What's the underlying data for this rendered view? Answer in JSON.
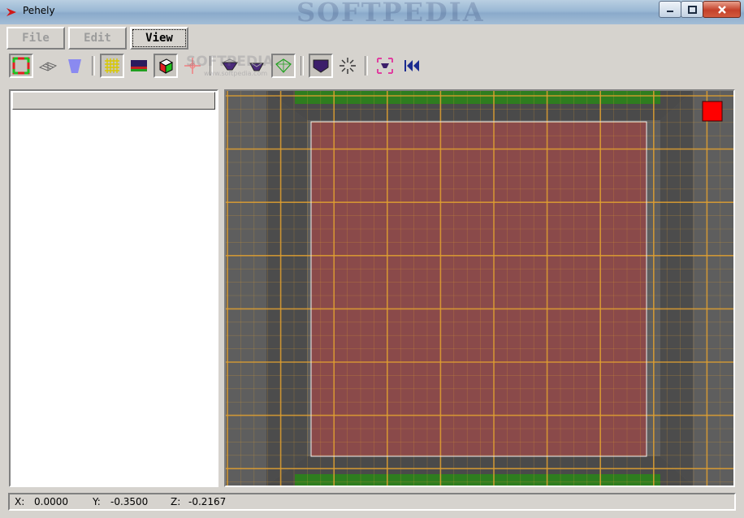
{
  "window": {
    "title": "Pehely",
    "watermark": "SOFTPEDIA"
  },
  "menu": {
    "tabs": [
      {
        "label": "File"
      },
      {
        "label": "Edit"
      },
      {
        "label": "View"
      }
    ]
  },
  "toolbar": {
    "watermark": "SOFTPEDIA",
    "watermark_url": "www.softpedia.com"
  },
  "status": {
    "x_label": "X:",
    "x_value": "0.0000",
    "y_label": "Y:",
    "y_value": "-0.3500",
    "z_label": "Z:",
    "z_value": "-0.2167"
  },
  "colors": {
    "viewport_bg": "#5e5e5e",
    "grid_line": "#e0a030",
    "board_fill": "#8a4a4a",
    "green_strip": "#2e7d1f",
    "marker": "#ff0000"
  }
}
